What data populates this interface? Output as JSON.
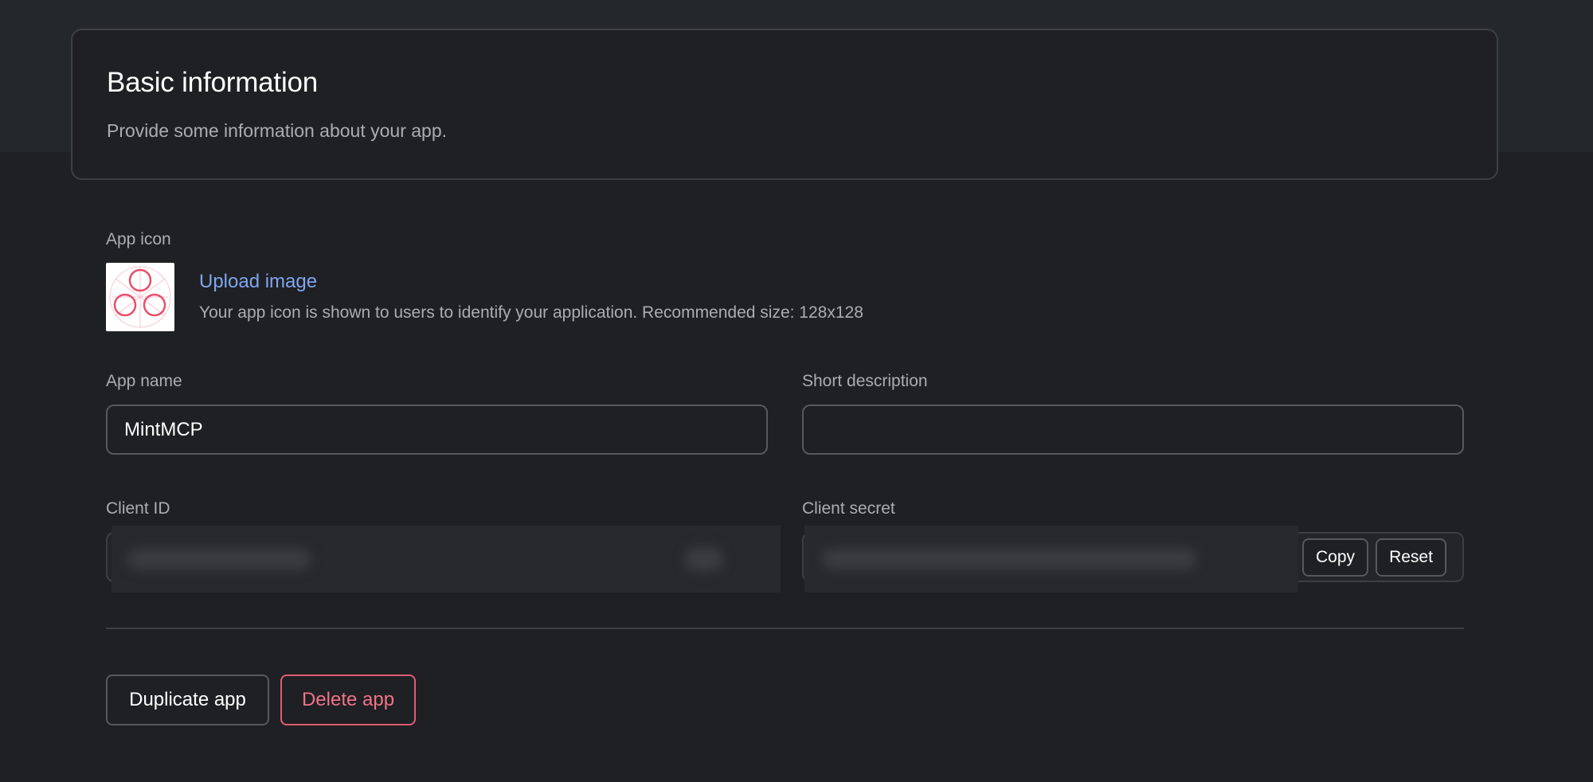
{
  "header": {
    "title": "Basic information",
    "subtitle": "Provide some information about your app."
  },
  "app_icon": {
    "label": "App icon",
    "upload_label": "Upload image",
    "hint": "Your app icon is shown to users to identify your application. Recommended size: 128x128",
    "icon_name": "app-logo-icon",
    "accent_color": "#e8506a"
  },
  "fields": {
    "app_name": {
      "label": "App name",
      "value": "MintMCP"
    },
    "short_description": {
      "label": "Short description",
      "value": "",
      "placeholder": ""
    },
    "client_id": {
      "label": "Client ID"
    },
    "client_secret": {
      "label": "Client secret",
      "copy_label": "Copy",
      "reset_label": "Reset"
    }
  },
  "actions": {
    "duplicate_label": "Duplicate app",
    "delete_label": "Delete app"
  },
  "colors": {
    "link": "#7fa6f0",
    "danger": "#f0738a",
    "background": "#1f2023"
  }
}
